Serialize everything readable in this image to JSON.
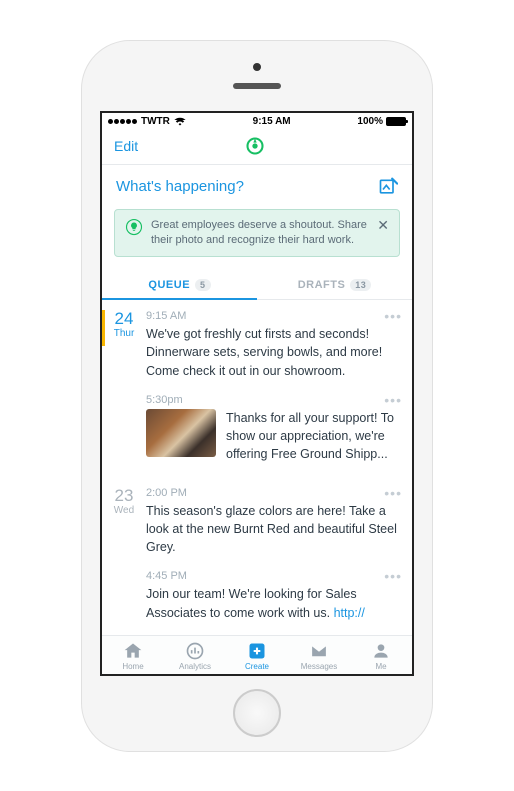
{
  "status": {
    "carrier": "TWTR",
    "time": "9:15 AM",
    "battery_pct": "100%"
  },
  "nav": {
    "edit": "Edit"
  },
  "compose": {
    "placeholder": "What's happening?"
  },
  "tip": {
    "text": "Great employees deserve a shoutout. Share their photo and recognize their hard work."
  },
  "tabs": {
    "queue": {
      "label": "QUEUE",
      "count": "5"
    },
    "drafts": {
      "label": "DRAFTS",
      "count": "13"
    }
  },
  "days": [
    {
      "num": "24",
      "name": "Thur",
      "posts": [
        {
          "time": "9:15 AM",
          "body": "We've got freshly cut firsts and seconds! Dinnerware sets, serving bowls, and more! Come check it out in our showroom."
        },
        {
          "time": "5:30pm",
          "body": "Thanks for all your support! To show our appreciation, we're offering Free Ground Shipp..."
        }
      ]
    },
    {
      "num": "23",
      "name": "Wed",
      "posts": [
        {
          "time": "2:00 PM",
          "body": "This season's glaze colors are here! Take a look at the new Burnt Red and beautiful Steel Grey."
        },
        {
          "time": "4:45 PM",
          "body": "Join our team! We're looking for Sales Associates to come work with us. ",
          "link": "http://"
        }
      ]
    }
  ],
  "tabbar": {
    "home": "Home",
    "analytics": "Analytics",
    "create": "Create",
    "messages": "Messages",
    "me": "Me"
  }
}
